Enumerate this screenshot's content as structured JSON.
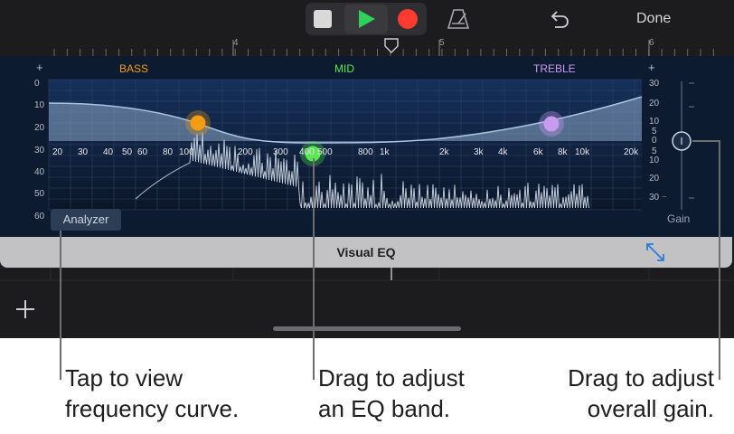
{
  "toolbar": {
    "stop_icon": "stop-icon",
    "play_icon": "play-icon",
    "record_icon": "record-icon",
    "metronome_icon": "metronome-icon",
    "undo_icon": "undo-icon",
    "done_label": "Done"
  },
  "ruler": {
    "bars": [
      "4",
      "5",
      "6"
    ]
  },
  "eq": {
    "bands": {
      "bass": "BASS",
      "mid": "MID",
      "treble": "TREBLE"
    },
    "band_colors": {
      "bass": "#f39c12",
      "mid": "#59e84f",
      "treble": "#c79cf0"
    },
    "plus_left": "+",
    "plus_right": "+",
    "db_left": [
      "0",
      "10",
      "20",
      "30",
      "40",
      "50",
      "60"
    ],
    "db_right": [
      "30",
      "20",
      "10",
      "5",
      "0",
      "5",
      "10",
      "20",
      "30"
    ],
    "db_right_bottom": "−",
    "freqs": [
      "20",
      "30",
      "40",
      "50",
      "60",
      "80",
      "100",
      "200",
      "300",
      "400",
      "500",
      "800",
      "1k",
      "2k",
      "3k",
      "4k",
      "6k",
      "8k",
      "10k",
      "20k"
    ],
    "analyzer_label": "Analyzer",
    "gain_label": "Gain"
  },
  "visual_eq": {
    "title": "Visual EQ",
    "expand_icon": "expand-icon"
  },
  "tracks": {
    "add_icon": "plus-icon"
  },
  "callouts": {
    "analyzer": [
      "Tap to view",
      "frequency curve."
    ],
    "band": [
      "Drag to adjust",
      "an EQ band."
    ],
    "gain": [
      "Drag to adjust",
      "overall gain."
    ]
  }
}
